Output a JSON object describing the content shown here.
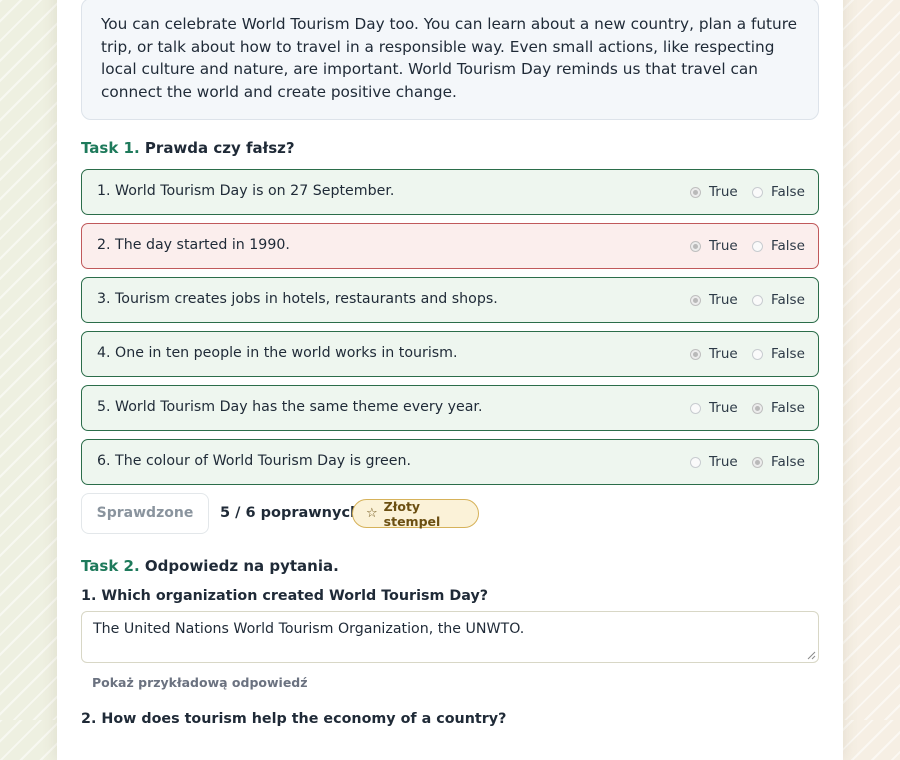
{
  "reading": {
    "text": "You can celebrate World Tourism Day too. You can learn about a new country, plan a future trip, or talk about how to travel in a responsible way. Even small actions, like respecting local culture and nature, are important. World Tourism Day reminds us that travel can connect the world and create positive change."
  },
  "task1": {
    "num": "Task 1.",
    "title": "Prawda czy fałsz?",
    "true_label": "True",
    "false_label": "False",
    "items": [
      {
        "text": "1. World Tourism Day is on 27 September.",
        "selected": "true",
        "correct": true
      },
      {
        "text": "2. The day started in 1990.",
        "selected": "true",
        "correct": false
      },
      {
        "text": "3. Tourism creates jobs in hotels, restaurants and shops.",
        "selected": "true",
        "correct": true
      },
      {
        "text": "4. One in ten people in the world works in tourism.",
        "selected": "true",
        "correct": true
      },
      {
        "text": "5. World Tourism Day has the same theme every year.",
        "selected": "false",
        "correct": true
      },
      {
        "text": "6. The colour of World Tourism Day is green.",
        "selected": "false",
        "correct": true
      }
    ],
    "check_label": "Sprawdzone",
    "score": "5 / 6 poprawnych",
    "badge": "Złoty stempel"
  },
  "task2": {
    "num": "Task 2.",
    "title": "Odpowiedz na pytania.",
    "q1": "1. Which organization created World Tourism Day?",
    "a1": "The United Nations World Tourism Organization, the UNWTO.",
    "hint": "Pokaż przykładową odpowiedź",
    "q2": "2. How does tourism help the economy of a country?"
  },
  "colors": {
    "accent_green": "#1e7a5b",
    "correct_border": "#2b6d4a",
    "wrong_border": "#c0595b",
    "badge_gold": "#d6b25a"
  }
}
